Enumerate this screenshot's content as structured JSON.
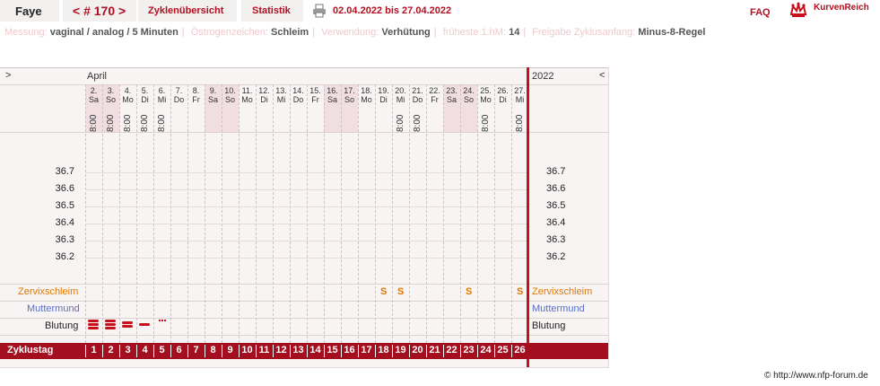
{
  "header": {
    "user_name": "Faye",
    "cycle_nav": "< # 170 >",
    "tabs": [
      {
        "label": "Zyklenübersicht"
      },
      {
        "label": "Statistik"
      }
    ],
    "date_range": "02.04.2022 bis 27.04.2022",
    "faq": "FAQ",
    "brand": "KurvenReich"
  },
  "info": {
    "messung_label": "Messung:",
    "messung_value": "vaginal / analog / 5 Minuten",
    "oestrogen_label": "Östrogenzeichen:",
    "oestrogen_value": "Schleim",
    "verwendung_label": "Verwendung:",
    "verwendung_value": "Verhütung",
    "frueheste_label": "früheste 1.hM:",
    "frueheste_value": "14",
    "freigabe_label": "Freigabe Zyklusanfang:",
    "freigabe_value": "Minus-8-Regel"
  },
  "chart": {
    "nav_left": ">",
    "nav_right": "<",
    "month": "April",
    "year": "2022",
    "dates": [
      "2.",
      "3.",
      "4.",
      "5.",
      "6.",
      "7.",
      "8.",
      "9.",
      "10.",
      "11.",
      "12.",
      "13.",
      "14.",
      "15.",
      "16.",
      "17.",
      "18.",
      "19.",
      "20.",
      "21.",
      "22.",
      "23.",
      "24.",
      "25.",
      "26.",
      "27."
    ],
    "weekdays": [
      "Sa",
      "So",
      "Mo",
      "Di",
      "Mi",
      "Do",
      "Fr",
      "Sa",
      "So",
      "Mo",
      "Di",
      "Mi",
      "Do",
      "Fr",
      "Sa",
      "So",
      "Mo",
      "Di",
      "Mi",
      "Do",
      "Fr",
      "Sa",
      "So",
      "Mo",
      "Di",
      "Mi"
    ],
    "weekend_flags": [
      true,
      true,
      false,
      false,
      false,
      false,
      false,
      true,
      true,
      false,
      false,
      false,
      false,
      false,
      true,
      true,
      false,
      false,
      false,
      false,
      false,
      true,
      true,
      false,
      false,
      false
    ],
    "times": [
      "8:00",
      "8:00",
      "8:00",
      "8:00",
      "8:00",
      "",
      "",
      "",
      "",
      "",
      "",
      "",
      "",
      "",
      "",
      "",
      "",
      "",
      "8:00",
      "8:00",
      "",
      "",
      "",
      "8:00",
      "",
      "8:00"
    ],
    "temp_ticks": [
      "36.7",
      "36.6",
      "36.5",
      "36.4",
      "36.3",
      "36.2"
    ],
    "row_labels": {
      "zervix": "Zervixschleim",
      "muttermund": "Muttermund",
      "blutung": "Blutung",
      "zyklustag": "Zyklustag"
    },
    "zervix_marks": [
      "",
      "",
      "",
      "",
      "",
      "",
      "",
      "",
      "",
      "",
      "",
      "",
      "",
      "",
      "",
      "",
      "",
      "S",
      "S",
      "",
      "",
      "",
      "S",
      "",
      "",
      "S"
    ],
    "blutung_levels": [
      3,
      3,
      2,
      1,
      0.5,
      0,
      0,
      0,
      0,
      0,
      0,
      0,
      0,
      0,
      0,
      0,
      0,
      0,
      0,
      0,
      0,
      0,
      0,
      0,
      0,
      0
    ],
    "cycle_days": [
      "1",
      "2",
      "3",
      "4",
      "5",
      "6",
      "7",
      "8",
      "9",
      "10",
      "11",
      "12",
      "13",
      "14",
      "15",
      "16",
      "17",
      "18",
      "19",
      "20",
      "21",
      "22",
      "23",
      "24",
      "25",
      "26"
    ],
    "colors": {
      "accent": "#b01020",
      "bar": "#a40f1f",
      "zervix": "#e07800",
      "muttermund": "#5a6fc4"
    }
  },
  "footer": {
    "copyright": "© http://www.nfp-forum.de"
  }
}
